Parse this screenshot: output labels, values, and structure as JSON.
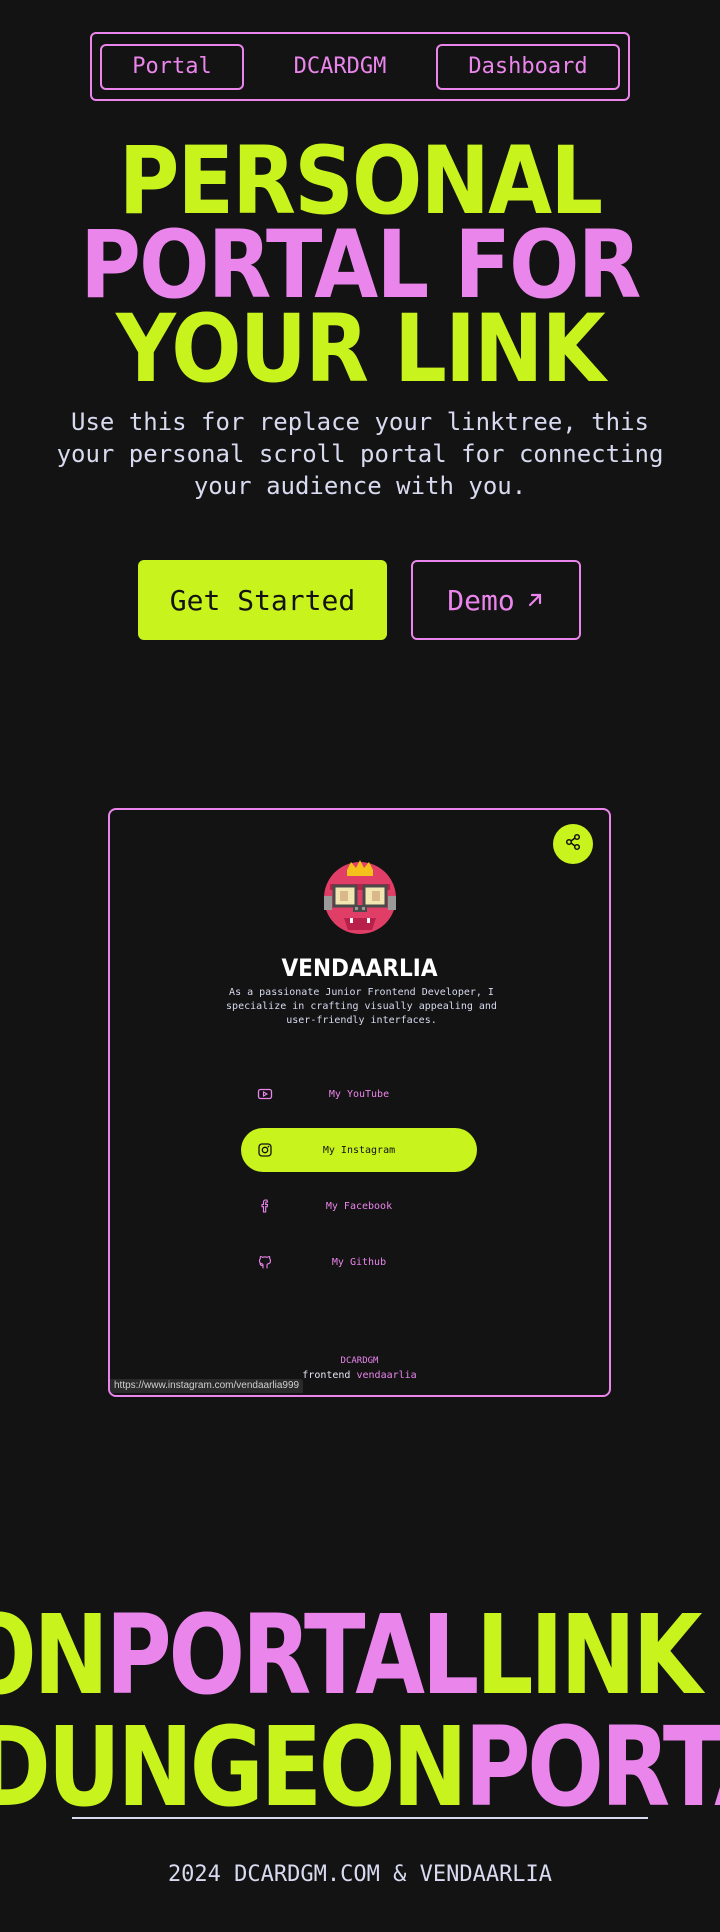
{
  "nav": {
    "portal_label": "Portal",
    "brand": "DCARDGM",
    "dashboard_label": "Dashboard"
  },
  "hero": {
    "title_line1": "PERSONAL",
    "title_line2": "PORTAL FOR",
    "title_line3": "YOUR LINK",
    "subtitle": "Use this for replace your linktree, this your personal scroll portal for connecting your audience with you.",
    "cta_primary": "Get Started",
    "cta_secondary": "Demo",
    "cta_secondary_icon": "arrow-up-right-icon"
  },
  "preview": {
    "share_icon": "share-icon",
    "avatar": "pixel-monster-avatar",
    "name": "VENDAARLIA",
    "bio": "As a passionate Junior Frontend Developer, I specialize in crafting visually appealing and user-friendly interfaces.",
    "links": [
      {
        "label": "My YouTube",
        "icon": "youtube-icon",
        "active": false
      },
      {
        "label": "My Instagram",
        "icon": "instagram-icon",
        "active": true
      },
      {
        "label": "My Facebook",
        "icon": "facebook-icon",
        "active": false
      },
      {
        "label": "My Github",
        "icon": "github-icon",
        "active": false
      }
    ],
    "brand": "DCARDGM",
    "credit_prefix": "frontend",
    "credit_name": "vendaarlia",
    "status_url": "https://www.instagram.com/vendaarlia999"
  },
  "marquee": {
    "row1": [
      {
        "text": "ON",
        "color": "lime"
      },
      {
        "text": "PORTAL",
        "color": "pink"
      },
      {
        "text": "LINK",
        "color": "lime"
      }
    ],
    "row2": [
      {
        "text": "DUNGEON",
        "color": "lime"
      },
      {
        "text": "PORTAL",
        "color": "pink"
      }
    ]
  },
  "footer": {
    "copyright": "2024 DCARDGM.COM & VENDAARLIA"
  },
  "colors": {
    "background": "#131313",
    "lime": "#c8f31d",
    "pink": "#ea85ec",
    "text": "#d8daf0"
  }
}
